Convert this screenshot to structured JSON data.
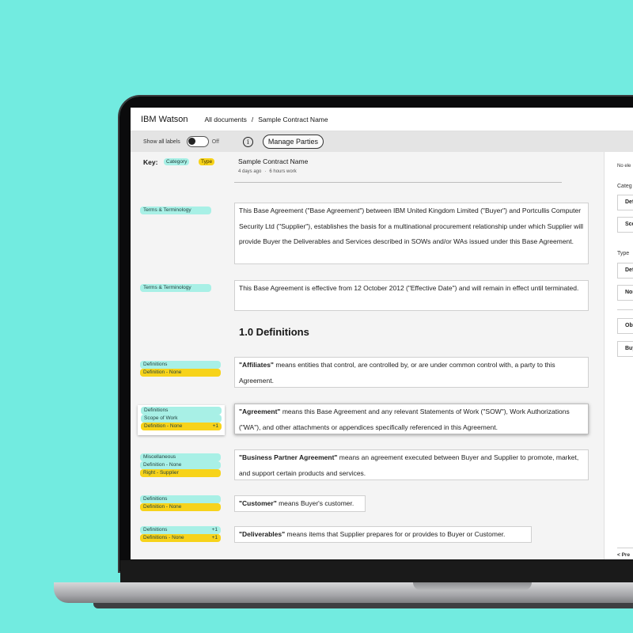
{
  "header": {
    "brand": "IBM Watson",
    "breadcrumb": [
      "All documents",
      "/",
      "Sample Contract Name"
    ]
  },
  "toolbar": {
    "show_all_labels": "Show all labels",
    "toggle_state": "Off",
    "manage_parties": "Manage Parties"
  },
  "key": {
    "label": "Key:",
    "category": "Category",
    "type": "Type"
  },
  "document": {
    "title": "Sample Contract Name",
    "modified": "4 days ago",
    "separator": "·",
    "work": "6 hours work"
  },
  "paragraphs": [
    {
      "labels": [
        {
          "text": "Terms & Terminology",
          "kind": "category"
        }
      ],
      "bold": "",
      "text": "This Base Agreement (\"Base Agreement\") between IBM United Kingdom Limited (\"Buyer\") and Portcullis Computer Security Ltd (\"Supplier\"), establishes the basis for a multinational procurement relationship under which Supplier will provide Buyer the Deliverables and Services described in SOWs and/or WAs issued under this Base Agreement."
    },
    {
      "labels": [
        {
          "text": "Terms & Terminology",
          "kind": "category"
        }
      ],
      "bold": "",
      "text": "This Base Agreement is effective from 12 October 2012 (\"Effective Date\") and will remain in effect until terminated."
    },
    {
      "labels": [
        {
          "text": "Definitions",
          "kind": "category"
        },
        {
          "text": "Definition - None",
          "kind": "type"
        }
      ],
      "bold": "\"Affiliates\"",
      "text": " means entities that control, are controlled by, or are under common control with, a party to this Agreement."
    },
    {
      "labels": [
        {
          "text": "Definitions",
          "kind": "category"
        },
        {
          "text": "Scope of Work",
          "kind": "category"
        },
        {
          "text": "Definition - None",
          "kind": "type",
          "extra": "+1"
        }
      ],
      "bold": "\"Agreement\"",
      "text": " means this Base Agreement and any relevant Statements of Work (\"SOW\"), Work Authorizations (\"WA\"), and other attachments or appendices specifically referenced in this Agreement."
    },
    {
      "labels": [
        {
          "text": "Miscellaneous",
          "kind": "category"
        },
        {
          "text": "Definition - None",
          "kind": "category"
        },
        {
          "text": "Right - Supplier",
          "kind": "type"
        }
      ],
      "bold": "\"Business Partner Agreement\"",
      "text": " means an agreement executed between Buyer and Supplier to promote, market, and support certain products and services."
    },
    {
      "labels": [
        {
          "text": "Definitions",
          "kind": "category"
        },
        {
          "text": "Definition - None",
          "kind": "type"
        }
      ],
      "bold": "\"Customer\"",
      "text": " means Buyer's customer."
    },
    {
      "labels": [
        {
          "text": "Definitions",
          "kind": "category",
          "extra": "+1"
        },
        {
          "text": "Definitions - None",
          "kind": "type",
          "extra": "+1"
        }
      ],
      "bold": "\"Deliverables\"",
      "text": " means items that Supplier prepares for or provides to Buyer or Customer."
    }
  ],
  "section_heading": "1.0 Definitions",
  "right_panel": {
    "no_elements": "No ele",
    "category_label": "Categ",
    "category_items": [
      "Def",
      "Sco"
    ],
    "type_label": "Type",
    "type_items": [
      "Def",
      "Nor"
    ],
    "party_items": [
      "Obl",
      "Buy"
    ],
    "footer": "< Pre"
  },
  "colors": {
    "background": "#72ebe0",
    "category_tag": "#a8f0e6",
    "type_tag": "#f7d31a"
  }
}
